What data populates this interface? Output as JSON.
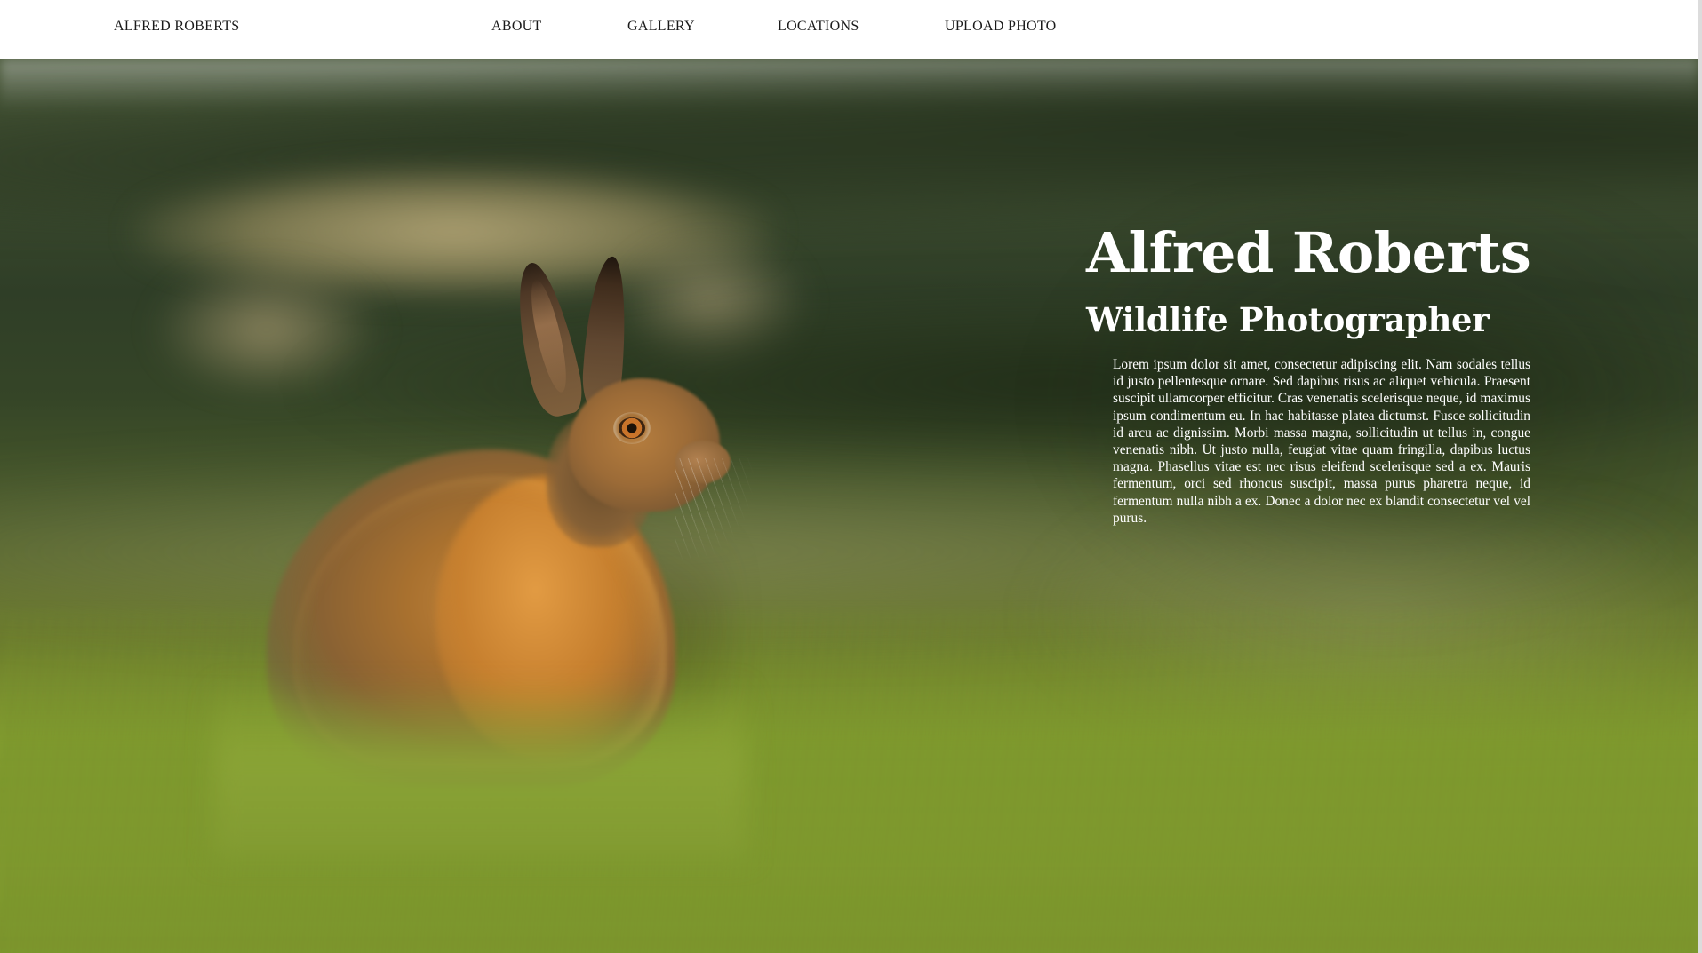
{
  "nav": {
    "brand": "ALFRED ROBERTS",
    "links": [
      {
        "label": "ABOUT"
      },
      {
        "label": "GALLERY"
      },
      {
        "label": "LOCATIONS"
      },
      {
        "label": "UPLOAD PHOTO"
      }
    ]
  },
  "hero": {
    "title": "Alfred Roberts",
    "subtitle": "Wildlife Photographer",
    "bio": "Lorem ipsum dolor sit amet, consectetur adipiscing elit. Nam sodales tellus id justo pellentesque ornare. Sed dapibus risus ac aliquet vehicula. Praesent suscipit ullamcorper efficitur. Cras venenatis scelerisque neque, id maximus ipsum condimentum eu. In hac habitasse platea dictumst. Fusce sollicitudin id arcu ac dignissim. Morbi massa magna, sollicitudin ut tellus in, congue venenatis nibh. Ut justo nulla, feugiat vitae quam fringilla, dapibus luctus magna. Phasellus vitae est nec risus eleifend scelerisque sed a ex. Mauris fermentum, orci sed rhoncus suscipit, massa purus pharetra neque, id fermentum nulla nibh a ex. Donec a dolor nec ex blandit consectetur vel vel purus."
  },
  "colors": {
    "nav_background": "#ffffff",
    "nav_text": "#1a1a1a",
    "hero_text": "#ffffff"
  }
}
